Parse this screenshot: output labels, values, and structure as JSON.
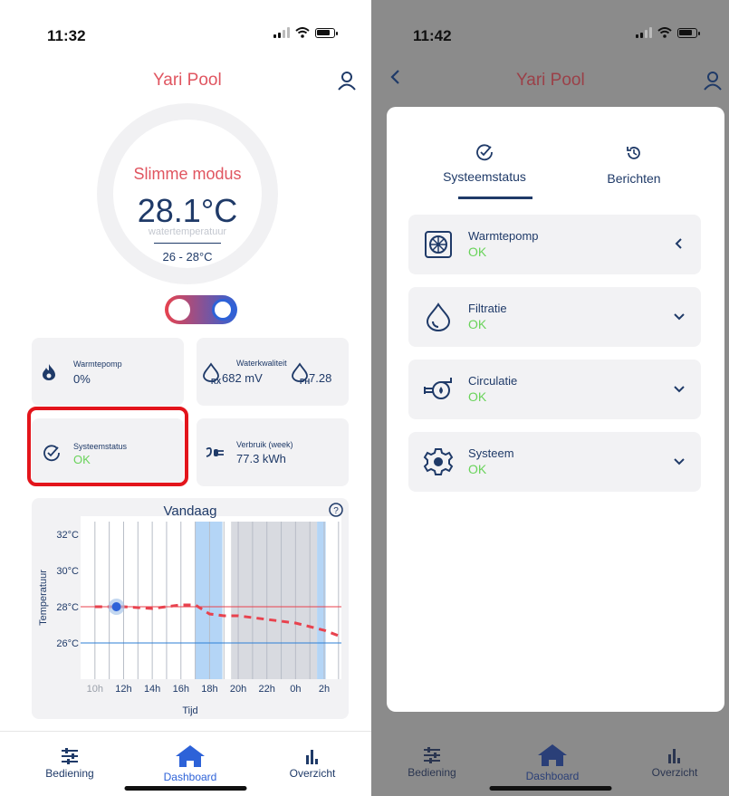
{
  "left": {
    "time": "11:32",
    "title": "Yari Pool",
    "mode": "Slimme modus",
    "temperature": "28.1°C",
    "temp_label": "watertemperatuur",
    "temp_range": "26 - 28°C",
    "cards": {
      "heatpump": {
        "label": "Warmtepomp",
        "value": "0%"
      },
      "water": {
        "label": "Waterkwaliteit",
        "rx_value": "682 mV",
        "ph_value": "7.28",
        "rx_sub": "RX",
        "ph_sub": "PH"
      },
      "system": {
        "label": "Systeemstatus",
        "value": "OK"
      },
      "usage": {
        "label": "Verbruik (week)",
        "value": "77.3 kWh"
      }
    },
    "chart_data": {
      "type": "line",
      "title": "Vandaag",
      "xlabel": "Tijd",
      "ylabel": "Temperatuur",
      "x_ticks": [
        "10h",
        "12h",
        "14h",
        "16h",
        "18h",
        "20h",
        "22h",
        "0h",
        "2h"
      ],
      "y_ticks": [
        "32°C",
        "30°C",
        "28°C",
        "26°C"
      ],
      "ylim": [
        24,
        33
      ],
      "series": [
        {
          "x": [
            10,
            12,
            14,
            16,
            17,
            18,
            19,
            20,
            22,
            24,
            25,
            26,
            27
          ],
          "y": [
            28.0,
            28.0,
            27.9,
            28.1,
            28.1,
            27.6,
            27.5,
            27.5,
            27.3,
            27.1,
            26.9,
            26.7,
            26.4
          ],
          "style": "dashed",
          "color": "#e8424e"
        }
      ],
      "reference_lines": [
        {
          "y": 28,
          "color": "#e8424e"
        },
        {
          "y": 26,
          "color": "#2d7fd6"
        }
      ],
      "current_point": {
        "x": 11.5,
        "y": 28.0
      },
      "highlight_bands": [
        {
          "from": 17,
          "to": 18.9,
          "color": "#b4d5f6"
        },
        {
          "from": 19.5,
          "to": 25.5,
          "color": "#d8dae0"
        },
        {
          "from": 25.5,
          "to": 26.1,
          "color": "#b4d5f6"
        }
      ]
    },
    "tabs": [
      "Bediening",
      "Dashboard",
      "Overzicht"
    ]
  },
  "right": {
    "time": "11:42",
    "title": "Yari Pool",
    "sheet_tabs": [
      "Systeemstatus",
      "Berichten"
    ],
    "items": [
      {
        "name": "Warmtepomp",
        "status": "OK"
      },
      {
        "name": "Filtratie",
        "status": "OK"
      },
      {
        "name": "Circulatie",
        "status": "OK"
      },
      {
        "name": "Systeem",
        "status": "OK"
      }
    ],
    "tabs": [
      "Bediening",
      "Dashboard",
      "Overzicht"
    ]
  },
  "colors": {
    "accent": "#e05560",
    "navy": "#1f3a68",
    "ok": "#69d35a",
    "highlight": "#e3141b"
  }
}
